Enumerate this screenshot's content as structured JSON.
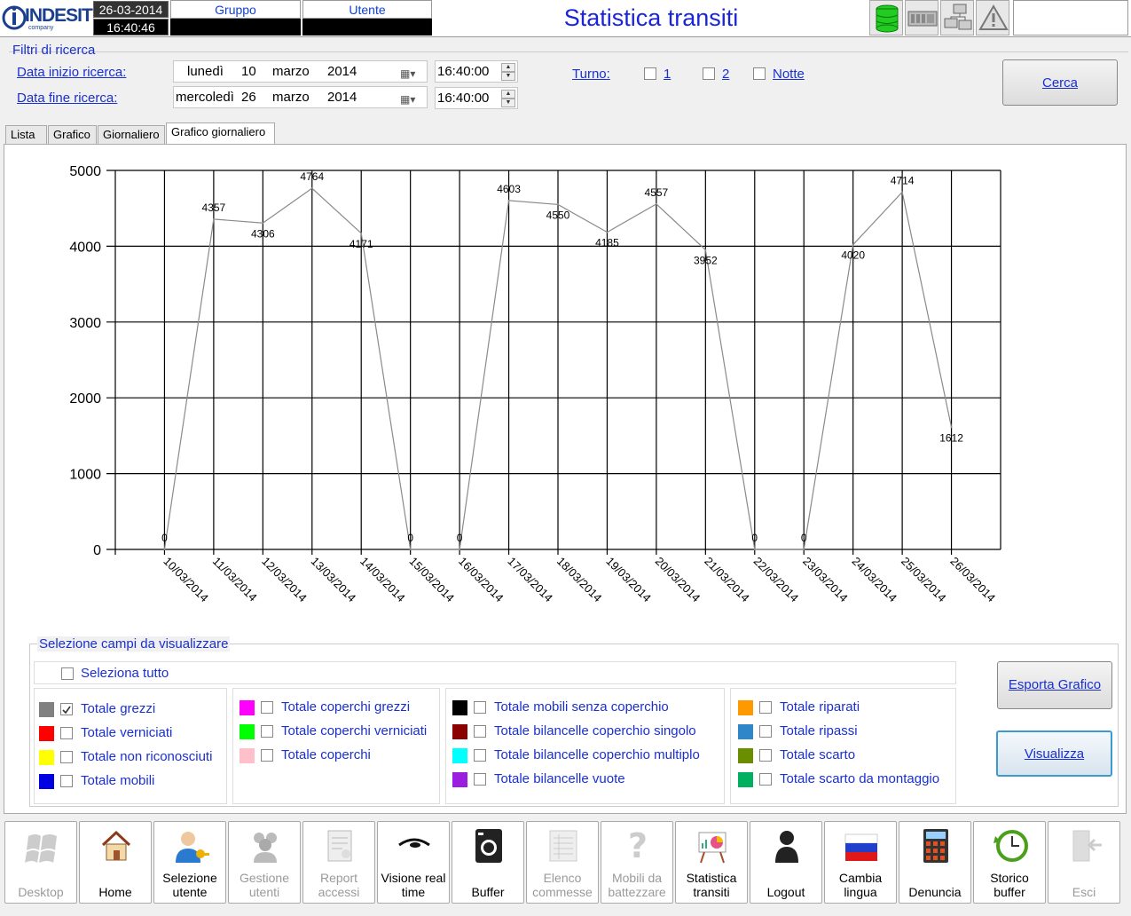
{
  "header": {
    "logo_text": "INDESIT",
    "logo_sub": "company",
    "date": "26-03-2014",
    "time": "16:40:46",
    "gruppo_label": "Gruppo",
    "utente_label": "Utente",
    "title": "Statistica transiti",
    "status_icons": [
      "database-icon",
      "plc-icon",
      "network-icon",
      "warning-icon"
    ]
  },
  "filters": {
    "section_title": "Filtri di ricerca",
    "start_label": "Data inizio ricerca:",
    "end_label": "Data fine ricerca:",
    "start": {
      "weekday": "lunedì",
      "day": "10",
      "month": "marzo",
      "year": "2014",
      "time": "16:40:00"
    },
    "end": {
      "weekday": "mercoledì",
      "day": "26",
      "month": "marzo",
      "year": "2014",
      "time": "16:40:00"
    },
    "turno_label": "Turno:",
    "turni": [
      "1",
      "2",
      "Notte"
    ],
    "search_button": "Cerca"
  },
  "tabs": [
    "Lista",
    "Grafico",
    "Giornaliero",
    "Grafico giornaliero"
  ],
  "active_tab": "Grafico giornaliero",
  "chart_data": {
    "type": "line",
    "title": "",
    "xlabel": "",
    "ylabel": "",
    "ylim": [
      0,
      5000
    ],
    "yticks": [
      "0",
      "1000",
      "2000",
      "3000",
      "4000",
      "5000"
    ],
    "grid": true,
    "categories": [
      "10/03/2014",
      "11/03/2014",
      "12/03/2014",
      "13/03/2014",
      "14/03/2014",
      "15/03/2014",
      "16/03/2014",
      "17/03/2014",
      "18/03/2014",
      "19/03/2014",
      "20/03/2014",
      "21/03/2014",
      "22/03/2014",
      "23/03/2014",
      "24/03/2014",
      "25/03/2014",
      "26/03/2014"
    ],
    "series": [
      {
        "values": [
          0,
          4357,
          4306,
          4764,
          4171,
          0,
          0,
          4603,
          4550,
          4185,
          4557,
          3952,
          0,
          0,
          4020,
          4714,
          1612
        ],
        "color": "#8a8a8a"
      }
    ]
  },
  "selection": {
    "title": "Selezione campi da visualizzare",
    "select_all": "Seleziona tutto",
    "groups": [
      [
        {
          "label": "Totale grezzi",
          "color": "#808080",
          "checked": true
        },
        {
          "label": "Totale verniciati",
          "color": "#ff0000",
          "checked": false
        },
        {
          "label": "Totale non riconosciuti",
          "color": "#ffff00",
          "checked": false
        },
        {
          "label": "Totale mobili",
          "color": "#0000e0",
          "checked": false
        }
      ],
      [
        {
          "label": "Totale coperchi grezzi",
          "color": "#ff00ff",
          "checked": false
        },
        {
          "label": "Totale coperchi verniciati",
          "color": "#00ff00",
          "checked": false
        },
        {
          "label": "Totale coperchi",
          "color": "#ffc0cb",
          "checked": false
        }
      ],
      [
        {
          "label": "Totale mobili senza coperchio",
          "color": "#000000",
          "checked": false
        },
        {
          "label": "Totale bilancelle coperchio singolo",
          "color": "#8b0000",
          "checked": false
        },
        {
          "label": "Totale bilancelle coperchio multiplo",
          "color": "#00ffff",
          "checked": false
        },
        {
          "label": "Totale bilancelle vuote",
          "color": "#9b1ee0",
          "checked": false
        }
      ],
      [
        {
          "label": "Totale riparati",
          "color": "#ff9900",
          "checked": false
        },
        {
          "label": "Totale ripassi",
          "color": "#2f86c8",
          "checked": false
        },
        {
          "label": "Totale scarto",
          "color": "#6b8e00",
          "checked": false
        },
        {
          "label": "Totale scarto da montaggio",
          "color": "#00b060",
          "checked": false
        }
      ]
    ],
    "export_button": "Esporta Grafico",
    "show_button": "Visualizza"
  },
  "toolbar": [
    {
      "label1": "",
      "label2": "Desktop",
      "icon": "windows-icon",
      "enabled": false
    },
    {
      "label1": "",
      "label2": "Home",
      "icon": "home-icon",
      "enabled": true
    },
    {
      "label1": "Selezione",
      "label2": "utente",
      "icon": "user-key-icon",
      "enabled": true
    },
    {
      "label1": "Gestione",
      "label2": "utenti",
      "icon": "users-icon",
      "enabled": false
    },
    {
      "label1": "Report",
      "label2": "accessi",
      "icon": "report-icon",
      "enabled": false
    },
    {
      "label1": "Visione real",
      "label2": "time",
      "icon": "eye-icon",
      "enabled": true
    },
    {
      "label1": "",
      "label2": "Buffer",
      "icon": "washer-icon",
      "enabled": true
    },
    {
      "label1": "Elenco",
      "label2": "commesse",
      "icon": "list-icon",
      "enabled": false
    },
    {
      "label1": "Mobili da",
      "label2": "battezzare",
      "icon": "question-icon",
      "enabled": false
    },
    {
      "label1": "Statistica",
      "label2": "transiti",
      "icon": "chart-board-icon",
      "enabled": true
    },
    {
      "label1": "",
      "label2": "Logout",
      "icon": "person-icon",
      "enabled": true
    },
    {
      "label1": "Cambia",
      "label2": "lingua",
      "icon": "flag-icon",
      "enabled": true
    },
    {
      "label1": "",
      "label2": "Denuncia",
      "icon": "calculator-icon",
      "enabled": true
    },
    {
      "label1": "Storico",
      "label2": "buffer",
      "icon": "clock-icon",
      "enabled": true
    },
    {
      "label1": "",
      "label2": "Esci",
      "icon": "exit-icon",
      "enabled": false
    }
  ]
}
